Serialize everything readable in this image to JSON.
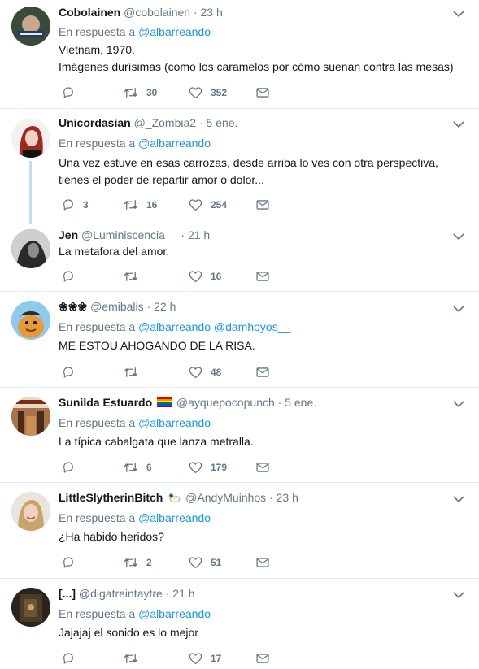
{
  "labels": {
    "reply_prefix": "En respuesta a"
  },
  "colors": {
    "link": "#1b95e0",
    "muted": "#657786",
    "text": "#14171a",
    "divider": "#e6ecf0",
    "thread_line": "#c4dbeb"
  },
  "tweets": [
    {
      "name": "Cobolainen",
      "handle": "@cobolainen",
      "sep": "·",
      "time": "23 h",
      "reply_to": [
        "@albarreando"
      ],
      "text": [
        "Vietnam, 1970.",
        "Imágenes durísimas (como los caramelos por cómo suenan contra las mesas)"
      ],
      "replies": "",
      "retweets": "30",
      "likes": "352"
    },
    {
      "name": "Unicordasian",
      "handle": "@_Zombia2",
      "sep": "·",
      "time": "5 ene.",
      "reply_to": [
        "@albarreando"
      ],
      "text": [
        "Una vez estuve en esas carrozas, desde arriba lo ves con otra perspectiva,",
        "tienes el poder de repartir amor o dolor..."
      ],
      "replies": "3",
      "retweets": "16",
      "likes": "254"
    },
    {
      "name": "Jen",
      "handle": "@Luminiscencia__",
      "sep": "·",
      "time": "21 h",
      "reply_to": [],
      "text": [
        "La metafora del amor."
      ],
      "replies": "",
      "retweets": "",
      "likes": "16"
    },
    {
      "name": "❀❀❀",
      "handle": "@emibalis",
      "sep": "·",
      "time": "22 h",
      "reply_to": [
        "@albarreando",
        "@damhoyos__"
      ],
      "text": [
        "ME ESTOU AHOGANDO DE LA RISA."
      ],
      "replies": "",
      "retweets": "",
      "likes": "48"
    },
    {
      "name": "Sunilda Estuardo",
      "handle": "@ayquepocopunch",
      "sep": "·",
      "time": "5 ene.",
      "reply_to": [
        "@albarreando"
      ],
      "text": [
        "La típica cabalgata que lanza metralla."
      ],
      "replies": "",
      "retweets": "6",
      "likes": "179"
    },
    {
      "name": "LittleSlytherinBitch",
      "handle": "@AndyMuinhos",
      "sep": "·",
      "time": "23 h",
      "reply_to": [
        "@albarreando"
      ],
      "text": [
        "¿Ha habido heridos?"
      ],
      "replies": "",
      "retweets": "2",
      "likes": "51"
    },
    {
      "name": "[...]",
      "handle": "@digatreintaytre",
      "sep": "·",
      "time": "21 h",
      "reply_to": [
        "@albarreando"
      ],
      "text": [
        "Jajajaj el sonido es lo mejor"
      ],
      "replies": "",
      "retweets": "",
      "likes": "17"
    }
  ]
}
